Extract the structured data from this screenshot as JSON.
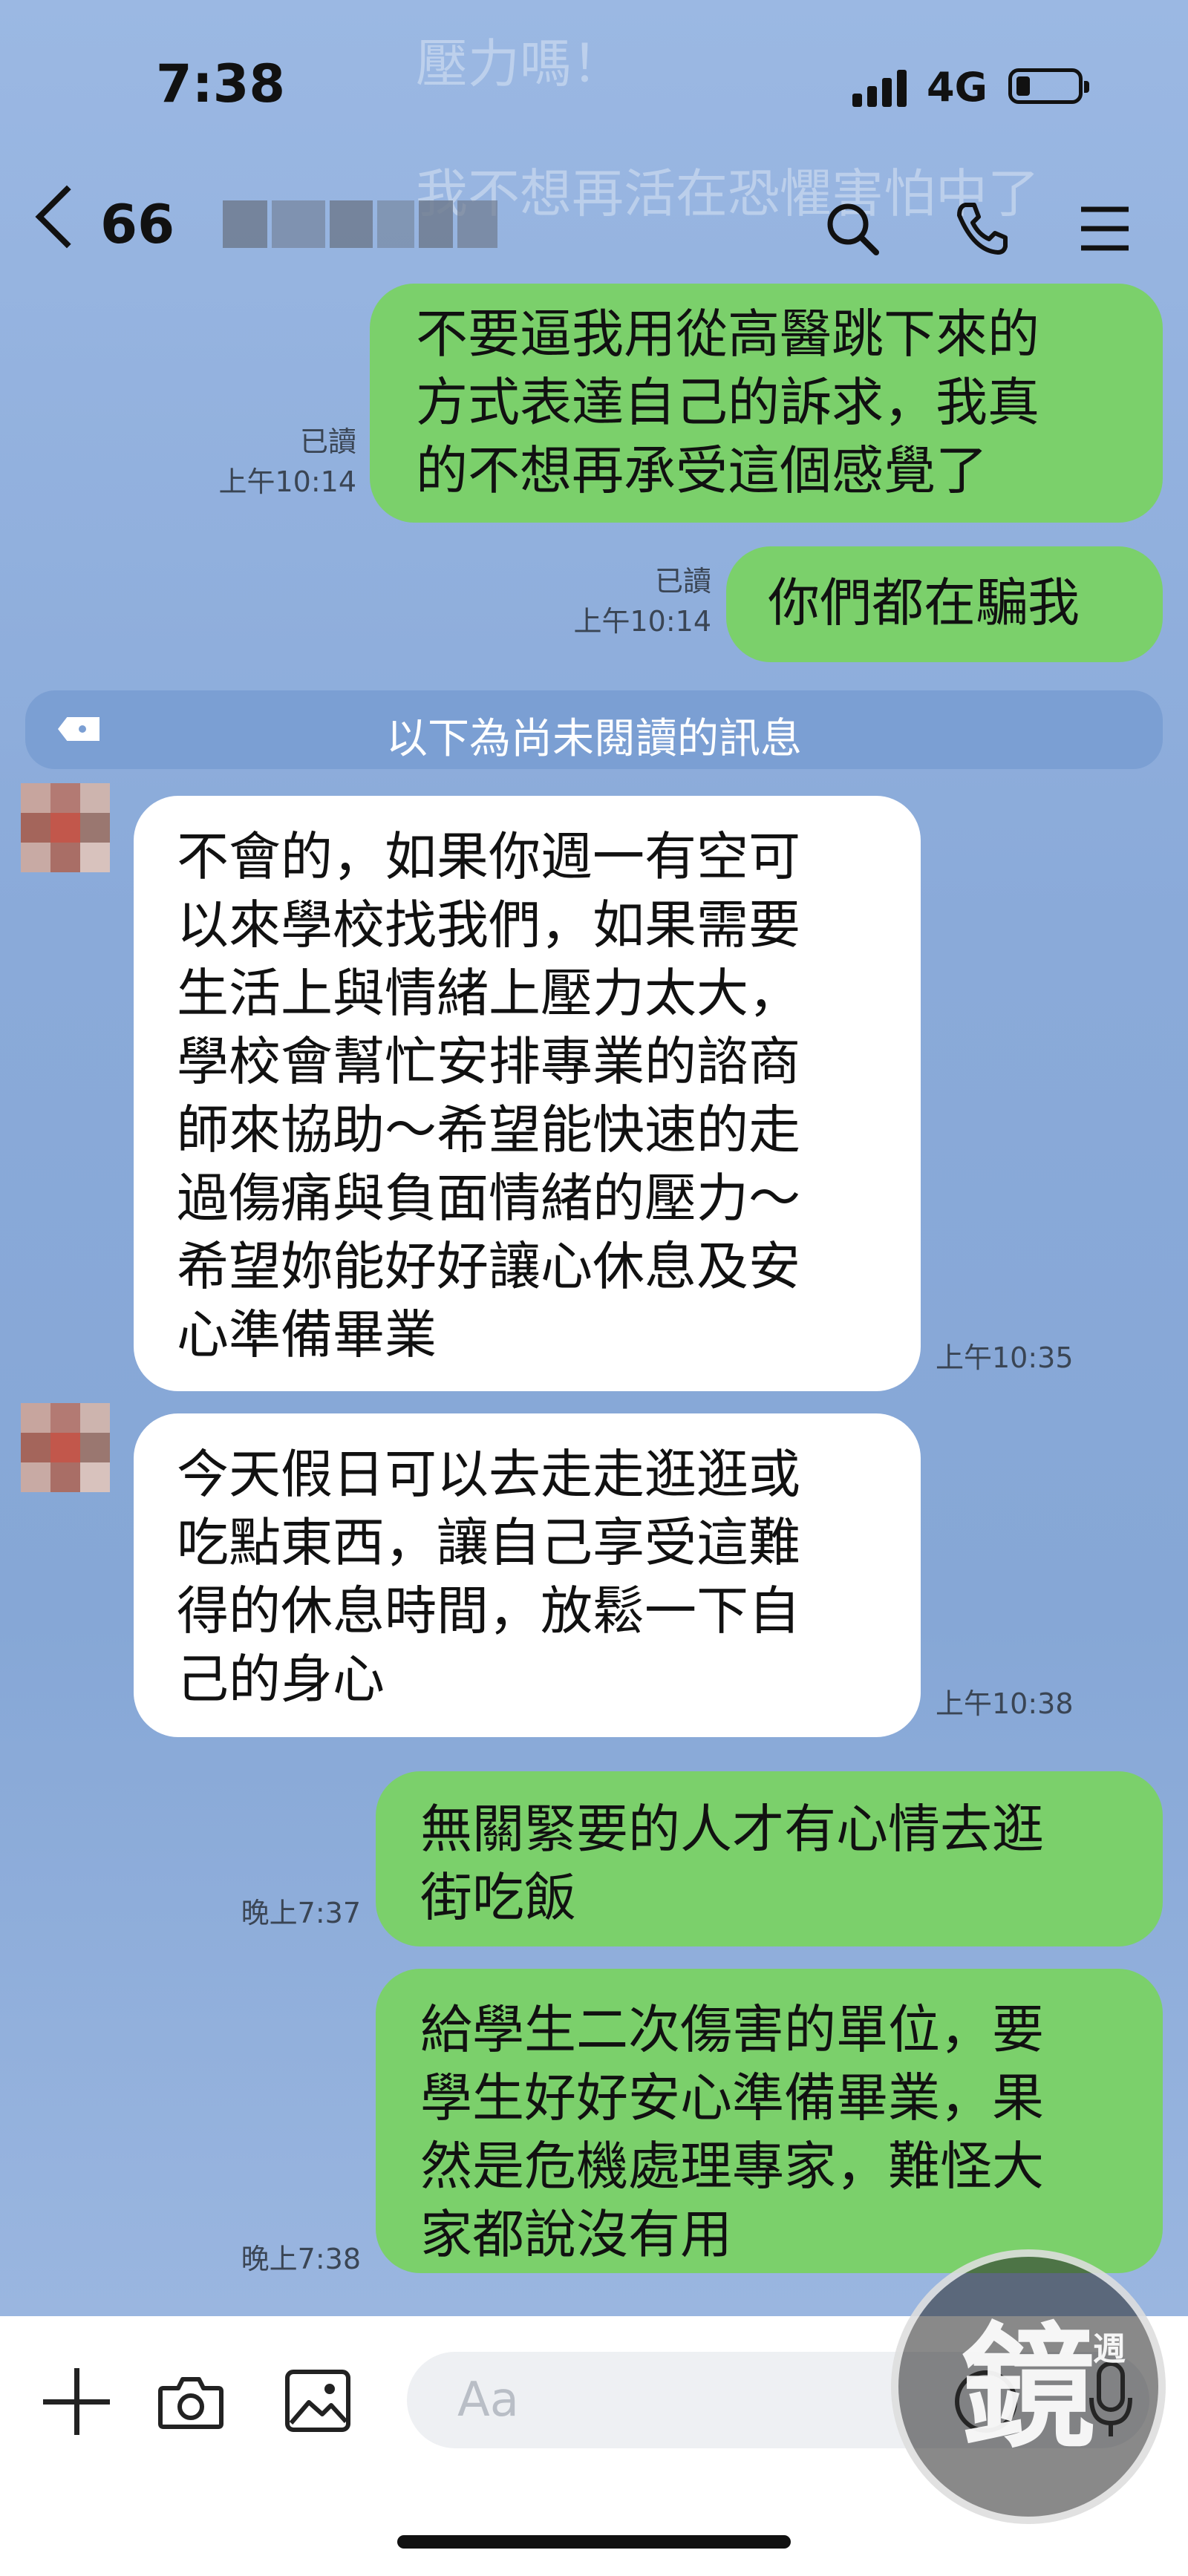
{
  "status_bar": {
    "time": "7:38",
    "network": "4G",
    "battery_level": 0.15
  },
  "header": {
    "contact_prefix": "66"
  },
  "ghost_lines": [
    "壓力嗎！",
    "我不想再活在恐懼害怕中了"
  ],
  "unread_divider": "以下為尚未閱讀的訊息",
  "messages": [
    {
      "direction": "out",
      "text": "不要逼我用從高醫跳下來的\n方式表達自己的訴求，我真\n的不想再承受這個感覺了",
      "read": "已讀",
      "time": "上午10:14"
    },
    {
      "direction": "out",
      "text": "你們都在騙我",
      "read": "已讀",
      "time": "上午10:14"
    },
    {
      "direction": "in",
      "text": "不會的，如果你週一有空可\n以來學校找我們，如果需要\n生活上與情緒上壓力太大，\n學校會幫忙安排專業的諮商\n師來協助～希望能快速的走\n過傷痛與負面情緒的壓力～\n希望妳能好好讓心休息及安\n心準備畢業",
      "time": "上午10:35"
    },
    {
      "direction": "in",
      "text": "今天假日可以去走走逛逛或\n吃點東西，讓自己享受這難\n得的休息時間，放鬆一下自\n己的身心",
      "time": "上午10:38"
    },
    {
      "direction": "out",
      "text": "無關緊要的人才有心情去逛\n街吃飯",
      "time": "晚上7:37"
    },
    {
      "direction": "out",
      "text": "給學生二次傷害的單位，要\n學生好好安心準備畢業，果\n然是危機處理專家，難怪大\n家都說沒有用",
      "time": "晚上7:38"
    }
  ],
  "input": {
    "placeholder": "Aa"
  },
  "icons": [
    "back-chevron-icon",
    "search-icon",
    "phone-icon",
    "menu-icon",
    "plus-icon",
    "camera-icon",
    "image-icon",
    "emoji-icon",
    "mic-icon"
  ],
  "watermark": {
    "text": "鏡",
    "sub": "週"
  },
  "colors": {
    "chat_bg": "#8fb0de",
    "outgoing_bubble": "#7bd06b",
    "incoming_bubble": "#ffffff",
    "divider": "#7b9fd3"
  }
}
